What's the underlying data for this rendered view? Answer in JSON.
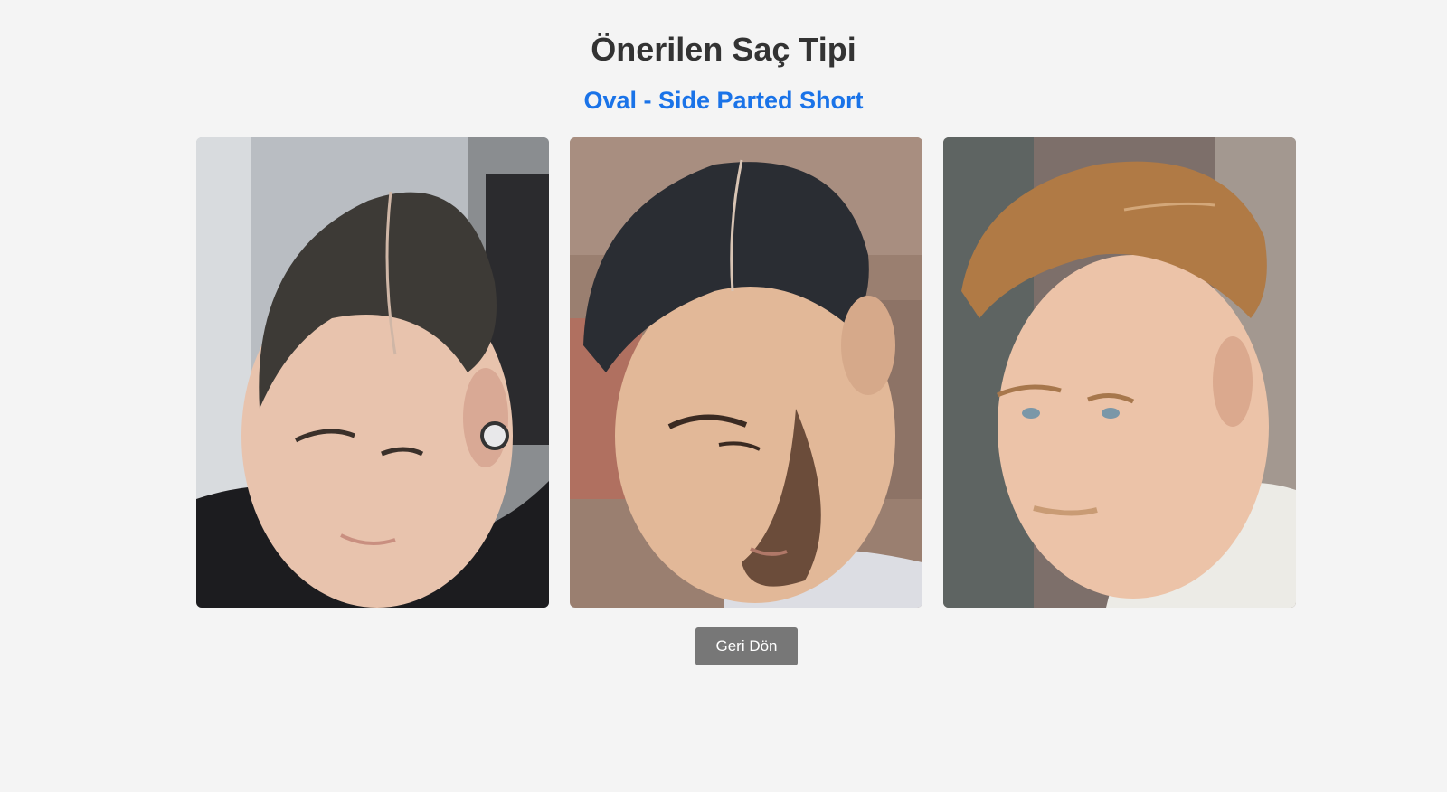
{
  "header": {
    "title": "Önerilen Saç Tipi",
    "subtitle": "Oval - Side Parted Short"
  },
  "gallery": {
    "photos": [
      {
        "name": "hairstyle-photo-1",
        "hair_color": "#3d3a36",
        "skin_color": "#e8c3ad",
        "bg_color": "#b9bdc2"
      },
      {
        "name": "hairstyle-photo-2",
        "hair_color": "#2a2d33",
        "skin_color": "#e2b898",
        "bg_color": "#9a7f70"
      },
      {
        "name": "hairstyle-photo-3",
        "hair_color": "#b07a45",
        "skin_color": "#ecc3a8",
        "bg_color": "#7d6f6a"
      }
    ]
  },
  "actions": {
    "back_label": "Geri Dön"
  },
  "colors": {
    "background": "#f4f4f4",
    "title": "#333333",
    "accent": "#1a73e8",
    "button": "#777777"
  }
}
